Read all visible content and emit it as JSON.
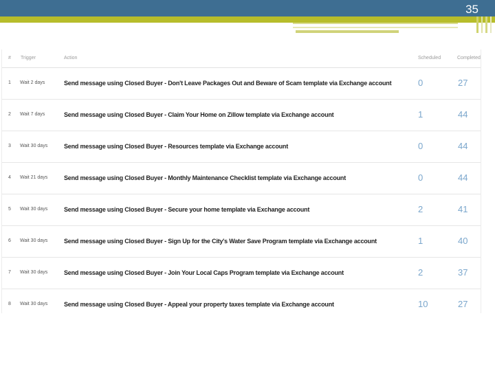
{
  "slide": {
    "number": "35"
  },
  "table": {
    "headers": {
      "num": "#",
      "trigger": "Trigger",
      "action": "Action",
      "scheduled": "Scheduled",
      "completed": "Completed"
    },
    "rows": [
      {
        "num": "1",
        "trigger": "Wait 2 days",
        "action": "Send message using Closed Buyer - Don't Leave Packages Out and Beware of Scam template via Exchange account",
        "scheduled": "0",
        "completed": "27"
      },
      {
        "num": "2",
        "trigger": "Wait 7 days",
        "action": "Send message using Closed Buyer - Claim Your Home on Zillow template via Exchange account",
        "scheduled": "1",
        "completed": "44"
      },
      {
        "num": "3",
        "trigger": "Wait 30 days",
        "action": "Send message using Closed Buyer - Resources template via Exchange account",
        "scheduled": "0",
        "completed": "44"
      },
      {
        "num": "4",
        "trigger": "Wait 21 days",
        "action": "Send message using Closed Buyer - Monthly Maintenance Checklist template via Exchange account",
        "scheduled": "0",
        "completed": "44"
      },
      {
        "num": "5",
        "trigger": "Wait 30 days",
        "action": "Send message using Closed Buyer - Secure your home template via Exchange account",
        "scheduled": "2",
        "completed": "41"
      },
      {
        "num": "6",
        "trigger": "Wait 30 days",
        "action": "Send message using Closed Buyer - Sign Up for the City's Water Save Program template via Exchange account",
        "scheduled": "1",
        "completed": "40"
      },
      {
        "num": "7",
        "trigger": "Wait 30 days",
        "action": "Send message using Closed Buyer - Join Your Local Caps Program template via Exchange account",
        "scheduled": "2",
        "completed": "37"
      },
      {
        "num": "8",
        "trigger": "Wait 30 days",
        "action": "Send message using Closed Buyer - Appeal your property taxes template via Exchange account",
        "scheduled": "10",
        "completed": "27"
      }
    ]
  },
  "colors": {
    "header_blue": "#3e6e92",
    "header_olive": "#b7bd2b",
    "count_blue": "#7aa6cc"
  }
}
